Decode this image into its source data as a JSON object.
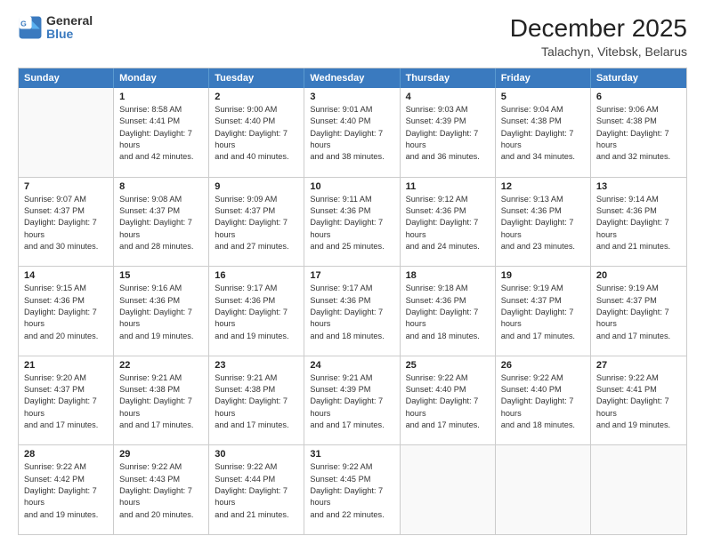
{
  "header": {
    "logo_line1": "General",
    "logo_line2": "Blue",
    "title": "December 2025",
    "subtitle": "Talachyn, Vitebsk, Belarus"
  },
  "days_of_week": [
    "Sunday",
    "Monday",
    "Tuesday",
    "Wednesday",
    "Thursday",
    "Friday",
    "Saturday"
  ],
  "weeks": [
    [
      {
        "day": "",
        "sunrise": "",
        "sunset": "",
        "daylight": ""
      },
      {
        "day": "1",
        "sunrise": "Sunrise: 8:58 AM",
        "sunset": "Sunset: 4:41 PM",
        "daylight": "Daylight: 7 hours and 42 minutes."
      },
      {
        "day": "2",
        "sunrise": "Sunrise: 9:00 AM",
        "sunset": "Sunset: 4:40 PM",
        "daylight": "Daylight: 7 hours and 40 minutes."
      },
      {
        "day": "3",
        "sunrise": "Sunrise: 9:01 AM",
        "sunset": "Sunset: 4:40 PM",
        "daylight": "Daylight: 7 hours and 38 minutes."
      },
      {
        "day": "4",
        "sunrise": "Sunrise: 9:03 AM",
        "sunset": "Sunset: 4:39 PM",
        "daylight": "Daylight: 7 hours and 36 minutes."
      },
      {
        "day": "5",
        "sunrise": "Sunrise: 9:04 AM",
        "sunset": "Sunset: 4:38 PM",
        "daylight": "Daylight: 7 hours and 34 minutes."
      },
      {
        "day": "6",
        "sunrise": "Sunrise: 9:06 AM",
        "sunset": "Sunset: 4:38 PM",
        "daylight": "Daylight: 7 hours and 32 minutes."
      }
    ],
    [
      {
        "day": "7",
        "sunrise": "Sunrise: 9:07 AM",
        "sunset": "Sunset: 4:37 PM",
        "daylight": "Daylight: 7 hours and 30 minutes."
      },
      {
        "day": "8",
        "sunrise": "Sunrise: 9:08 AM",
        "sunset": "Sunset: 4:37 PM",
        "daylight": "Daylight: 7 hours and 28 minutes."
      },
      {
        "day": "9",
        "sunrise": "Sunrise: 9:09 AM",
        "sunset": "Sunset: 4:37 PM",
        "daylight": "Daylight: 7 hours and 27 minutes."
      },
      {
        "day": "10",
        "sunrise": "Sunrise: 9:11 AM",
        "sunset": "Sunset: 4:36 PM",
        "daylight": "Daylight: 7 hours and 25 minutes."
      },
      {
        "day": "11",
        "sunrise": "Sunrise: 9:12 AM",
        "sunset": "Sunset: 4:36 PM",
        "daylight": "Daylight: 7 hours and 24 minutes."
      },
      {
        "day": "12",
        "sunrise": "Sunrise: 9:13 AM",
        "sunset": "Sunset: 4:36 PM",
        "daylight": "Daylight: 7 hours and 23 minutes."
      },
      {
        "day": "13",
        "sunrise": "Sunrise: 9:14 AM",
        "sunset": "Sunset: 4:36 PM",
        "daylight": "Daylight: 7 hours and 21 minutes."
      }
    ],
    [
      {
        "day": "14",
        "sunrise": "Sunrise: 9:15 AM",
        "sunset": "Sunset: 4:36 PM",
        "daylight": "Daylight: 7 hours and 20 minutes."
      },
      {
        "day": "15",
        "sunrise": "Sunrise: 9:16 AM",
        "sunset": "Sunset: 4:36 PM",
        "daylight": "Daylight: 7 hours and 19 minutes."
      },
      {
        "day": "16",
        "sunrise": "Sunrise: 9:17 AM",
        "sunset": "Sunset: 4:36 PM",
        "daylight": "Daylight: 7 hours and 19 minutes."
      },
      {
        "day": "17",
        "sunrise": "Sunrise: 9:17 AM",
        "sunset": "Sunset: 4:36 PM",
        "daylight": "Daylight: 7 hours and 18 minutes."
      },
      {
        "day": "18",
        "sunrise": "Sunrise: 9:18 AM",
        "sunset": "Sunset: 4:36 PM",
        "daylight": "Daylight: 7 hours and 18 minutes."
      },
      {
        "day": "19",
        "sunrise": "Sunrise: 9:19 AM",
        "sunset": "Sunset: 4:37 PM",
        "daylight": "Daylight: 7 hours and 17 minutes."
      },
      {
        "day": "20",
        "sunrise": "Sunrise: 9:19 AM",
        "sunset": "Sunset: 4:37 PM",
        "daylight": "Daylight: 7 hours and 17 minutes."
      }
    ],
    [
      {
        "day": "21",
        "sunrise": "Sunrise: 9:20 AM",
        "sunset": "Sunset: 4:37 PM",
        "daylight": "Daylight: 7 hours and 17 minutes."
      },
      {
        "day": "22",
        "sunrise": "Sunrise: 9:21 AM",
        "sunset": "Sunset: 4:38 PM",
        "daylight": "Daylight: 7 hours and 17 minutes."
      },
      {
        "day": "23",
        "sunrise": "Sunrise: 9:21 AM",
        "sunset": "Sunset: 4:38 PM",
        "daylight": "Daylight: 7 hours and 17 minutes."
      },
      {
        "day": "24",
        "sunrise": "Sunrise: 9:21 AM",
        "sunset": "Sunset: 4:39 PM",
        "daylight": "Daylight: 7 hours and 17 minutes."
      },
      {
        "day": "25",
        "sunrise": "Sunrise: 9:22 AM",
        "sunset": "Sunset: 4:40 PM",
        "daylight": "Daylight: 7 hours and 17 minutes."
      },
      {
        "day": "26",
        "sunrise": "Sunrise: 9:22 AM",
        "sunset": "Sunset: 4:40 PM",
        "daylight": "Daylight: 7 hours and 18 minutes."
      },
      {
        "day": "27",
        "sunrise": "Sunrise: 9:22 AM",
        "sunset": "Sunset: 4:41 PM",
        "daylight": "Daylight: 7 hours and 19 minutes."
      }
    ],
    [
      {
        "day": "28",
        "sunrise": "Sunrise: 9:22 AM",
        "sunset": "Sunset: 4:42 PM",
        "daylight": "Daylight: 7 hours and 19 minutes."
      },
      {
        "day": "29",
        "sunrise": "Sunrise: 9:22 AM",
        "sunset": "Sunset: 4:43 PM",
        "daylight": "Daylight: 7 hours and 20 minutes."
      },
      {
        "day": "30",
        "sunrise": "Sunrise: 9:22 AM",
        "sunset": "Sunset: 4:44 PM",
        "daylight": "Daylight: 7 hours and 21 minutes."
      },
      {
        "day": "31",
        "sunrise": "Sunrise: 9:22 AM",
        "sunset": "Sunset: 4:45 PM",
        "daylight": "Daylight: 7 hours and 22 minutes."
      },
      {
        "day": "",
        "sunrise": "",
        "sunset": "",
        "daylight": ""
      },
      {
        "day": "",
        "sunrise": "",
        "sunset": "",
        "daylight": ""
      },
      {
        "day": "",
        "sunrise": "",
        "sunset": "",
        "daylight": ""
      }
    ]
  ]
}
